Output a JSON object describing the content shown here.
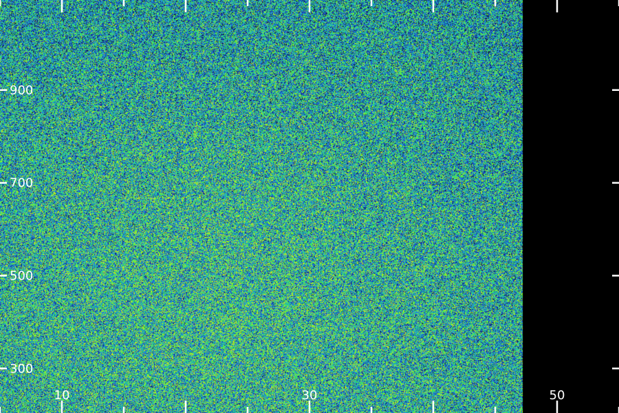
{
  "chart_data": {
    "type": "heatmap",
    "title": "",
    "xlabel": "",
    "ylabel": "",
    "xlim": [
      5,
      55
    ],
    "ylim": [
      204,
      1094
    ],
    "x_ticks_major": [
      10,
      20,
      30,
      40,
      50
    ],
    "x_ticks_minor": [
      5,
      15,
      25,
      35,
      45,
      55
    ],
    "x_tick_labels": [
      "10",
      "30",
      "50"
    ],
    "y_ticks": [
      300,
      500,
      700,
      900
    ],
    "y_tick_labels": [
      "300",
      "500",
      "700",
      "900"
    ],
    "data_extent": {
      "x_max": 47.2
    },
    "grid": false,
    "legend": "none",
    "colormap": {
      "name": "viridis-like",
      "colors": [
        "#0b1a4a",
        "#1736a6",
        "#1f6fe0",
        "#22a7c8",
        "#2ad88a",
        "#55f03a",
        "#cfe81a"
      ]
    },
    "background_color": "#000000",
    "axis_color": "#ffffff",
    "noise": {
      "description": "random speckle intensity field",
      "mean_bias_center_x": 22,
      "mean_bias_center_y": 520
    }
  }
}
